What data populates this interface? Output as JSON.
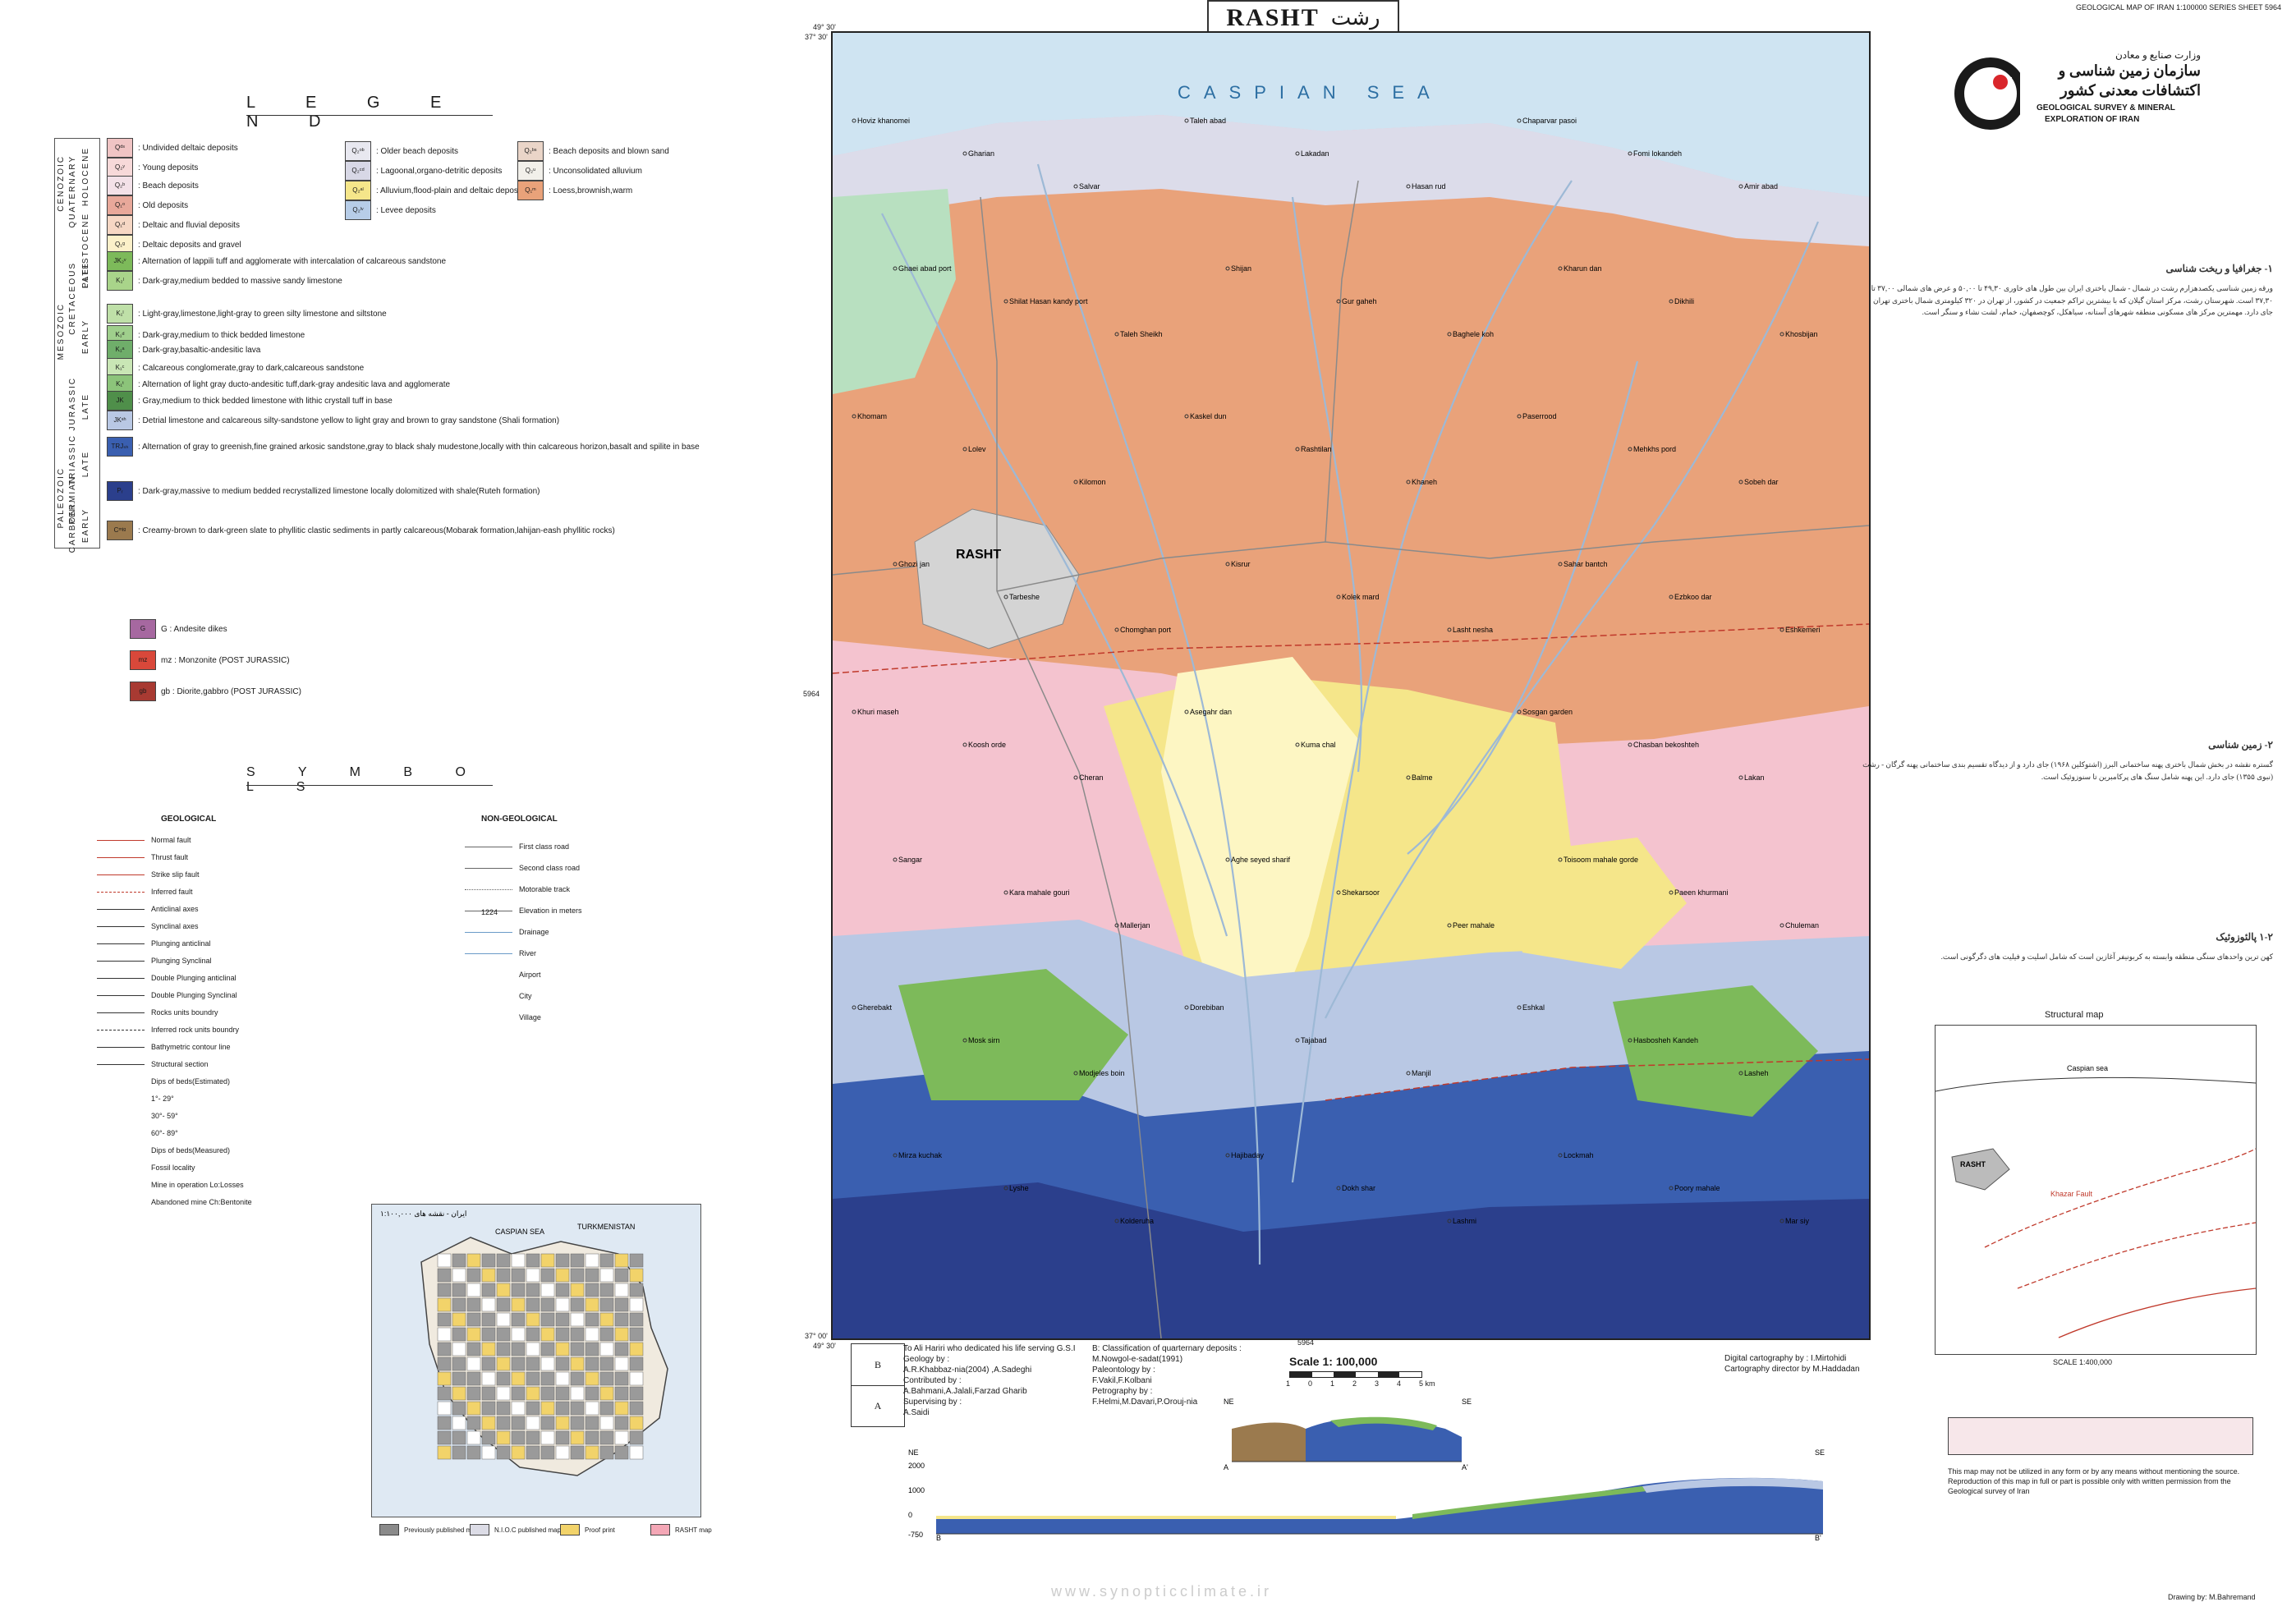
{
  "header": {
    "title_en": "RASHT",
    "title_fa": "رشت",
    "sheet_series": "GEOLOGICAL MAP OF IRAN 1:100000 SERIES SHEET 5964"
  },
  "legend": {
    "title": "L E G E N D",
    "eras": [
      "CENOZOIC",
      "MESOZOIC",
      "PALEOZOIC"
    ],
    "periods": [
      "QUATERNARY",
      "CRETACEOUS",
      "JURASSIC",
      "TRIASSIC",
      "PERMIAN",
      "CARBONI."
    ],
    "epochs": [
      "HOLOCENE",
      "PLEISTOCENE",
      "LATE",
      "EARLY",
      "LATE",
      "LATE",
      "EARLY"
    ],
    "units_left": [
      {
        "code": "Qᵈˢ",
        "color": "#f0c4c4",
        "label": ": Undivided deltaic deposits"
      },
      {
        "code": "Q₂ʸ",
        "color": "#f7d9d9",
        "label": ": Young deposits"
      },
      {
        "code": "Q₂ᵇ",
        "color": "#f3e1e8",
        "label": ": Beach deposits"
      },
      {
        "code": "Q₁ᵒ",
        "color": "#e8a89a",
        "label": ": Old deposits"
      },
      {
        "code": "Q₁ᵈ",
        "color": "#f6d7c4",
        "label": ": Deltaic and fluvial deposits"
      },
      {
        "code": "Q₁ᵍ",
        "color": "#fbf0c9",
        "label": ": Deltaic deposits and gravel"
      },
      {
        "code": "JK₂ᵛ",
        "color": "#7dba5a",
        "label": ": Alternation of lappili tuff and agglomerate with intercalation of calcareous sandstone"
      },
      {
        "code": "K₂ˡ",
        "color": "#a9d48a",
        "label": ": Dark-gray,medium bedded to massive sandy limestone"
      },
      {
        "code": "K₁ˡ",
        "color": "#bfe0a8",
        "label": ": Light-gray,limestone,light-gray to green silty limestone and siltstone"
      },
      {
        "code": "K₁ᵈ",
        "color": "#9fcf8c",
        "label": ": Dark-gray,medium to thick bedded limestone"
      },
      {
        "code": "K₁ᵃ",
        "color": "#6fae6a",
        "label": ": Dark-gray,basaltic-andesitic lava"
      },
      {
        "code": "K₁ᶜ",
        "color": "#c9e6b5",
        "label": ": Calcareous conglomerate,gray to dark,calcareous sandstone"
      },
      {
        "code": "K₁ᵗ",
        "color": "#8cc47a",
        "label": ": Alternation of light gray ducto-andesitic tuff,dark-gray andesitic lava and agglomerate"
      },
      {
        "code": "JK",
        "color": "#4f8f4a",
        "label": ": Gray,medium to thick bedded limestone with lithic crystall tuff in base"
      },
      {
        "code": "JKˢʰ",
        "color": "#b9c8e4",
        "label": ": Detrial limestone and calcareous silty-sandstone yellow to light gray and brown to gray sandstone (Shali formation)"
      },
      {
        "code": "TRJₛₕ",
        "color": "#3a5fb0",
        "label": ": Alternation of gray to greenish,fine grained arkosic sandstone,gray to black shaly mudestone,locally with thin calcareous horizon,basalt and spilite in base"
      },
      {
        "code": "Pᵣ",
        "color": "#2b3f8c",
        "label": ": Dark-gray,massive to medium bedded recrystallized limestone locally dolomitized with shale(Ruteh formation)"
      },
      {
        "code": "Cᵐʲᵍ",
        "color": "#9b7a4e",
        "label": ": Creamy-brown to dark-green slate to phyllitic clastic sediments in partly calcareous(Mobarak formation,lahijan-eash phyllitic rocks)"
      }
    ],
    "units_right": [
      {
        "code": "Q₂ᵒᵇ",
        "color": "#e8e8f0",
        "label": ": Older beach deposits"
      },
      {
        "code": "Q₂ᶜᵈ",
        "color": "#d8d8e6",
        "label": ": Lagoonal,organo-detritic deposits"
      },
      {
        "code": "Q₂ᵃˡ",
        "color": "#f5e68a",
        "label": ": Alluvium,flood-plain and deltaic deposits"
      },
      {
        "code": "Q₂ˡᵛ",
        "color": "#b7cde8",
        "label": ": Levee deposits"
      },
      {
        "code": "Q₂ᵇˢ",
        "color": "#ead5c8",
        "label": ": Beach deposits and blown sand"
      },
      {
        "code": "Q₂ᵘ",
        "color": "#f2f0ea",
        "label": ": Unconsolidated alluvium"
      },
      {
        "code": "Q₁ᵐ",
        "color": "#e9a27a",
        "label": ": Loess,brownish,warm"
      }
    ],
    "intrusives": [
      {
        "code": "G",
        "color": "#a668a0",
        "label": "G : Andesite dikes"
      },
      {
        "code": "mz",
        "color": "#d9483a",
        "label": "mz : Monzonite (POST JURASSIC)"
      },
      {
        "code": "gb",
        "color": "#a83a32",
        "label": "gb : Diorite,gabbro (POST JURASSIC)"
      }
    ]
  },
  "symbols": {
    "title": "S Y M B O L S",
    "geological_head": "GEOLOGICAL",
    "non_geological_head": "NON-GEOLOGICAL",
    "geological": [
      "Normal fault",
      "Thrust fault",
      "Strike slip fault",
      "Inferred fault",
      "Anticlinal axes",
      "Synclinal axes",
      "Plunging anticlinal",
      "Plunging Synclinal",
      "Double Plunging anticlinal",
      "Double Plunging Synclinal",
      "Rocks units boundry",
      "Inferred rock units boundry",
      "Bathymetric contour line",
      "Structural section",
      "Dips of beds(Estimated)",
      "1°- 29°",
      "30°- 59°",
      "60°- 89°",
      "Dips of beds(Measured)",
      "Fossil locality",
      "Mine in operation Lo:Losses",
      "Abandoned mine Ch:Bentonite"
    ],
    "non_geological": [
      "First class road",
      "Second class road",
      "Motorable track",
      "Elevation in meters",
      "Drainage",
      "River",
      "Airport",
      "City",
      "Village"
    ],
    "elevation_example": "1224"
  },
  "map": {
    "sea_label": "CASPIAN SEA",
    "city_label": "RASHT",
    "coords": {
      "top_left_lat": "37° 30'",
      "top_left_lon": "49° 30'",
      "bottom_left_lat": "37° 00'",
      "bottom_left_lon": "49° 30'",
      "side_lon": "5964",
      "bottom_mid": "5964"
    },
    "places": [
      "Hoviz khanomei",
      "Gharian",
      "Salvar",
      "Taleh abad",
      "Lakadan",
      "Hasan rud",
      "Chaparvar pasoi",
      "Fomi lokandeh",
      "Amir abad",
      "Ghaei abad port",
      "Shilat Hasan kandy port",
      "Taleh Sheikh",
      "Shijan",
      "Gur gaheh",
      "Baghele koh",
      "Kharun dan",
      "Dikhili",
      "Khosbijan",
      "Khomam",
      "Lolev",
      "Kilomon",
      "Kaskel dun",
      "Rashtilan",
      "Khaneh",
      "Paserrood",
      "Mehkhs pord",
      "Sobeh dar",
      "Ghozi jan",
      "Tarbeshe",
      "Chomghan port",
      "Kisrur",
      "Kolek mard",
      "Lasht nesha",
      "Sahar bantch",
      "Ezbkoo dar",
      "Eshkemeri",
      "Khuri maseh",
      "Koosh orde",
      "Cheran",
      "Asegahr dan",
      "Kuma chal",
      "Balme",
      "Sosgan garden",
      "Chasban bekoshteh",
      "Lakan",
      "Sangar",
      "Kara mahale gouri",
      "Mallerjan",
      "Aghe seyed sharif",
      "Shekarsoor",
      "Peer mahale",
      "Toisoom mahale gorde",
      "Paeen khurmani",
      "Chuleman",
      "Gherebakt",
      "Mosk sirn",
      "Modjeles boin",
      "Dorebiban",
      "Tajabad",
      "Manjil",
      "Eshkal",
      "Hasbosheh Kandeh",
      "Lasheh",
      "Mirza kuchak",
      "Lyshe",
      "Kolderuha",
      "Hajibaday",
      "Dokh shar",
      "Lashmi",
      "Lockmah",
      "Poory mahale",
      "Mar siy"
    ]
  },
  "right_text": {
    "org_fa_line1": "وزارت صنایع و معادن",
    "org_fa_line2": "سازمان زمین شناسی و",
    "org_fa_line3": "اکتشافات معدنی کشور",
    "org_en_line1": "GEOLOGICAL SURVEY & MINERAL",
    "org_en_line2": "EXPLORATION OF IRAN",
    "sec1_heading": "۱- جغرافیا و ریخت شناسی",
    "sec1_text": "ورقه زمین شناسی یکصدهزارم رشت در شمال - شمال باختری ایران بین طول های خاوری ۴۹,۳۰ تا ۵۰,۰۰ و عرض های شمالی ۳۷,۰۰ تا ۳۷,۳۰ است. شهرستان رشت، مرکز استان گیلان که با بیشترین تراکم جمعیت در کشور، از تهران در ۳۲۰ کیلومتری شمال باختری تهران جای دارد. مهمترین مرکز های مسکونی منطقه شهرهای آستانه، سیاهکل، کوچصفهان، خمام، لشت نشاء و سنگر است.",
    "sec2_heading": "۲- زمین شناسی",
    "sec2_text": "گستره نقشه در بخش شمال باختری پهنه ساختمانی البرز (اشتوکلین ۱۹۶۸) جای دارد و از دیدگاه تقسیم بندی ساختمانی پهنه گرگان - رشت (نبوی ۱۳۵۵) جای دارد. این پهنه شامل سنگ های پرکامبرین تا سنوزوئیک است.",
    "sec3_heading": "۱-۲ پالئوزوئیک",
    "sec3_text": "کهن ترین واحدهای سنگی منطقه وابسته به کربونیفر آغازین است که شامل اسلیت و فیلیت های دگرگونی است.",
    "structural_map_title": "Structural map",
    "structural_caspian": "Caspian sea",
    "structural_rasht": "RASHT",
    "structural_fault": "Khazar Fault",
    "structural_scale": "SCALE 1:400,000",
    "copyright_text": "This map may not be utilized in any form or by any means without mentioning the source. Reproduction of this map in full or part is possible only with written permission from the Geological survey of Iran",
    "drawing_by": "Drawing by: M.Bahremand"
  },
  "bottom": {
    "box_labels": [
      "B",
      "A"
    ],
    "credits_left": [
      "To Ali Hariri who dedicated his life serving G.S.I",
      "Geology by :",
      "A.R.Khabbaz-nia(2004) ,A.Sadeghi",
      "Contributed by :",
      "A.Bahmani,A.Jalali,Farzad Gharib",
      "Supervising by :",
      "A.Saidi"
    ],
    "credits_mid": [
      "B: Classification of quarternary deposits :",
      "M.Nowgol-e-sadat(1991)",
      "Paleontology by :",
      "F.Vakil,F.Kolbani",
      "Petrography by :",
      "F.Helmi,M.Davari,P.Orouj-nia"
    ],
    "credits_right": [
      "Digital cartography by : I.Mirtohidi",
      "Cartography director by M.Haddadan"
    ],
    "scale_label": "Scale 1: 100,000",
    "scale_ticks": [
      "1",
      "0",
      "1",
      "2",
      "3",
      "4",
      "5 km"
    ],
    "section_labels": {
      "ne": "NE",
      "se": "SE",
      "a": "A",
      "a_prime": "A'",
      "b": "B",
      "b_prime": "B'"
    },
    "section_elev": [
      "2000",
      "1000",
      "0",
      "-750"
    ],
    "inset_title": "ایران - نقشه های ۱:۱۰۰,۰۰۰",
    "inset_caspian": "CASPIAN SEA",
    "inset_turkmenistan": "TURKMENISTAN",
    "inset_legend": [
      "Previously published map",
      "N.I.O.C published map",
      "Proof print",
      "RASHT map"
    ]
  },
  "watermark": "www.synopticclimate.ir",
  "colors": {
    "coastal_plain": "#e9a27a",
    "beach": "#dcdcea",
    "sea": "#cfe4f2",
    "alluvium": "#f5e68a",
    "delta_light": "#fdf6c3",
    "shaly": "#3a5fb0",
    "limestone_dark": "#2b3f8c",
    "shali": "#b9c8e4",
    "cretaceous_green": "#7dba5a",
    "old_deposits_pink": "#f4c3cf",
    "urban_gray": "#d4d4d4"
  }
}
